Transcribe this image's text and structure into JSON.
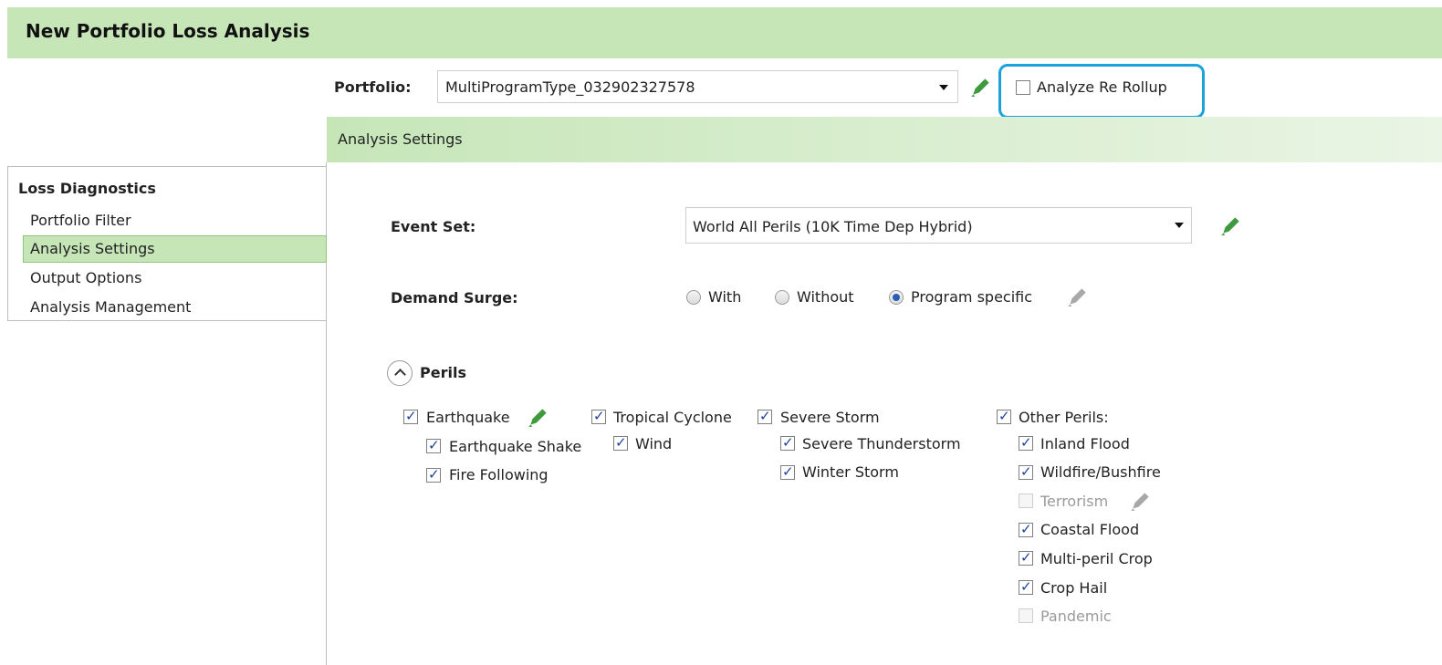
{
  "window": {
    "title": "New Portfolio Loss Analysis"
  },
  "portfolio": {
    "label": "Portfolio:",
    "selected": "MultiProgramType_032902327578",
    "rollup_label": "Analyze Re Rollup",
    "rollup_checked": false
  },
  "section": {
    "title": "Analysis Settings"
  },
  "nav": {
    "heading": "Loss Diagnostics",
    "items": [
      {
        "label": "Portfolio Filter",
        "active": false
      },
      {
        "label": "Analysis Settings",
        "active": true
      },
      {
        "label": "Output Options",
        "active": false
      },
      {
        "label": "Analysis Management",
        "active": false
      }
    ]
  },
  "event_set": {
    "label": "Event Set:",
    "selected": "World All Perils (10K Time Dep Hybrid)"
  },
  "demand_surge": {
    "label": "Demand Surge:",
    "options": [
      "With",
      "Without",
      "Program specific"
    ],
    "selected": "Program specific"
  },
  "perils": {
    "title": "Perils",
    "earthquake": {
      "label": "Earthquake",
      "shake": "Earthquake Shake",
      "fire": "Fire Following"
    },
    "tropical": {
      "label": "Tropical Cyclone",
      "wind": "Wind"
    },
    "severe": {
      "label": "Severe Storm",
      "thunder": "Severe Thunderstorm",
      "winter": "Winter Storm"
    },
    "other": {
      "label": "Other Perils:",
      "inland": "Inland Flood",
      "wildfire": "Wildfire/Bushfire",
      "terrorism": "Terrorism",
      "coastal": "Coastal Flood",
      "crop": "Multi-peril Crop",
      "hail": "Crop Hail",
      "pandemic": "Pandemic"
    }
  },
  "colors": {
    "accent": "#c6e6b8",
    "highlight": "#1aa3dd",
    "pencil_active": "#3f9a3c",
    "pencil_disabled": "#a8a8a8"
  }
}
